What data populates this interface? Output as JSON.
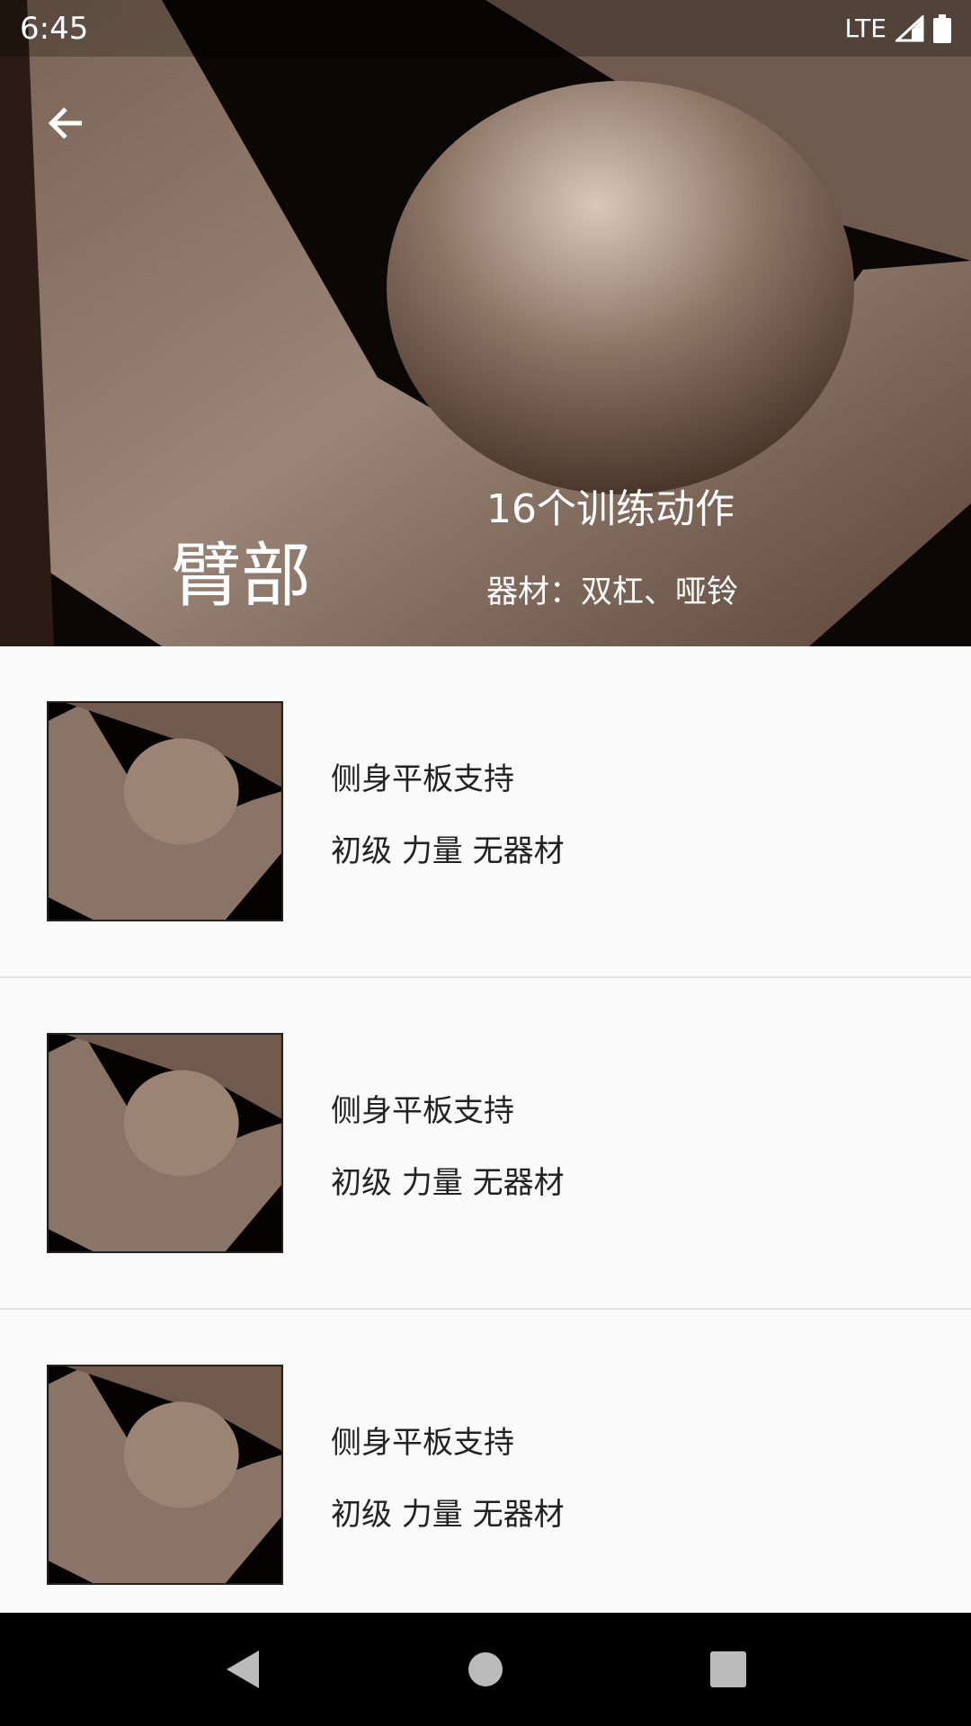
{
  "status_bar": {
    "time": "6:45",
    "network": "LTE"
  },
  "header": {
    "title": "臂部",
    "exercise_count": "16个训练动作",
    "equipment": "器材：双杠、哑铃"
  },
  "exercises": [
    {
      "name": "侧身平板支持",
      "tags": "初级 力量 无器材"
    },
    {
      "name": "侧身平板支持",
      "tags": "初级 力量 无器材"
    },
    {
      "name": "侧身平板支持",
      "tags": "初级 力量 无器材"
    }
  ]
}
